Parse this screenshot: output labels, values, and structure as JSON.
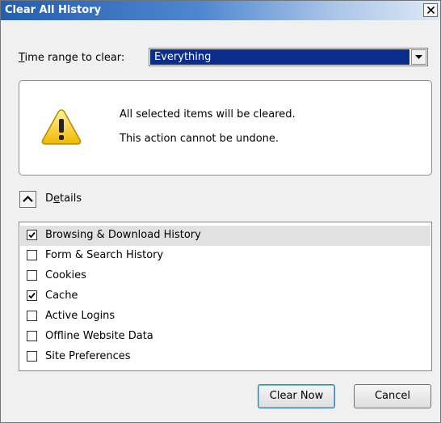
{
  "window": {
    "title": "Clear All History",
    "close_icon": "close-icon"
  },
  "time_range": {
    "label_accel": "T",
    "label_rest": "ime range to clear:",
    "selected": "Everything"
  },
  "warning": {
    "icon": "warning-icon",
    "line1": "All selected items will be cleared.",
    "line2": "This action cannot be undone."
  },
  "details": {
    "label_pre": "D",
    "label_accel": "e",
    "label_post": "tails",
    "expanded": true
  },
  "items": [
    {
      "label": "Browsing & Download History",
      "checked": true,
      "selected": true
    },
    {
      "label": "Form & Search History",
      "checked": false,
      "selected": false
    },
    {
      "label": "Cookies",
      "checked": false,
      "selected": false
    },
    {
      "label": "Cache",
      "checked": true,
      "selected": false
    },
    {
      "label": "Active Logins",
      "checked": false,
      "selected": false
    },
    {
      "label": "Offline Website Data",
      "checked": false,
      "selected": false
    },
    {
      "label": "Site Preferences",
      "checked": false,
      "selected": false
    }
  ],
  "buttons": {
    "clear_now": "Clear Now",
    "cancel": "Cancel"
  }
}
